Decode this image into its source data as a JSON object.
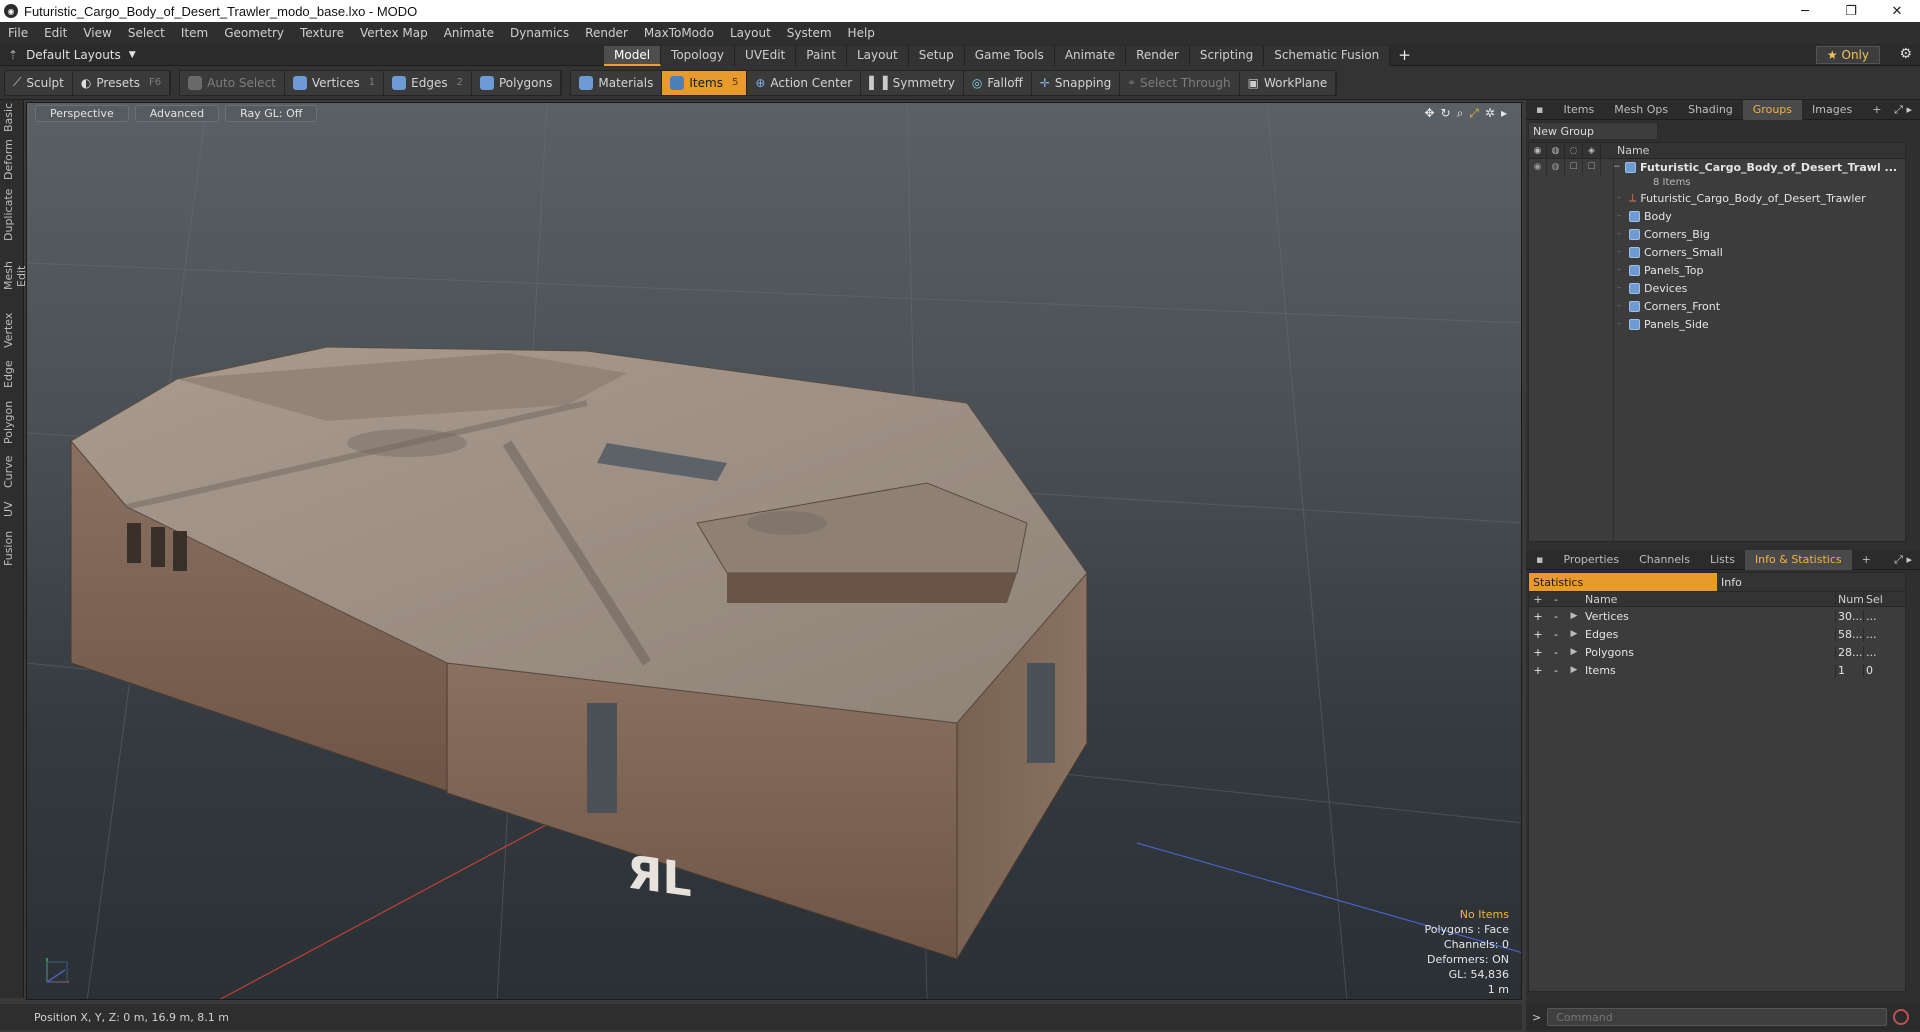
{
  "window": {
    "title": "Futuristic_Cargo_Body_of_Desert_Trawler_modo_base.lxo - MODO",
    "minimize": "─",
    "maximize": "❐",
    "close": "✕"
  },
  "menu": [
    "File",
    "Edit",
    "View",
    "Select",
    "Item",
    "Geometry",
    "Texture",
    "Vertex Map",
    "Animate",
    "Dynamics",
    "Render",
    "MaxToModo",
    "Layout",
    "System",
    "Help"
  ],
  "layout_bar": {
    "layout_selector": "Default Layouts",
    "tabs": [
      "Model",
      "Topology",
      "UVEdit",
      "Paint",
      "Layout",
      "Setup",
      "Game Tools",
      "Animate",
      "Render",
      "Scripting",
      "Schematic Fusion"
    ],
    "active_tab": "Model",
    "plus": "+",
    "only_label": "Only"
  },
  "toolbar": {
    "sculpt": "Sculpt",
    "presets": "Presets",
    "presets_key": "F6",
    "auto_select": "Auto Select",
    "vertices": "Vertices",
    "vertices_num": "1",
    "edges": "Edges",
    "edges_num": "2",
    "polygons": "Polygons",
    "materials": "Materials",
    "items": "Items",
    "items_num": "5",
    "action_center": "Action Center",
    "symmetry": "Symmetry",
    "falloff": "Falloff",
    "snapping": "Snapping",
    "select_through": "Select Through",
    "workplane": "WorkPlane"
  },
  "left_tabs": [
    "Basic",
    "Deform",
    "Duplicate",
    "Mesh Edit",
    "Vertex",
    "Edge",
    "Polygon",
    "Curve",
    "UV",
    "Fusion"
  ],
  "viewport": {
    "view_mode": "Perspective",
    "shading": "Advanced",
    "raygl": "Ray GL: Off",
    "info": {
      "items": "No Items",
      "polygons": "Polygons : Face",
      "channels": "Channels: 0",
      "deformers": "Deformers: ON",
      "gl": "GL: 54,836",
      "scale": "1 m"
    },
    "decal_text": "ЯL"
  },
  "status": {
    "position": "Position X, Y, Z:  0 m, 16.9 m, 8.1 m"
  },
  "top_panel": {
    "tabs": [
      "Items",
      "Mesh Ops",
      "Shading",
      "Groups",
      "Images"
    ],
    "active_tab": "Groups",
    "new_group": "New Group",
    "col_name": "Name",
    "group_name": "Futuristic_Cargo_Body_of_Desert_Trawl ...",
    "group_count": "8 Items",
    "children": [
      {
        "label": "Futuristic_Cargo_Body_of_Desert_Trawler",
        "icon": "locator-icon"
      },
      {
        "label": "Body",
        "icon": "mesh-icon"
      },
      {
        "label": "Corners_Big",
        "icon": "mesh-icon"
      },
      {
        "label": "Corners_Small",
        "icon": "mesh-icon"
      },
      {
        "label": "Panels_Top",
        "icon": "mesh-icon"
      },
      {
        "label": "Devices",
        "icon": "mesh-icon"
      },
      {
        "label": "Corners_Front",
        "icon": "mesh-icon"
      },
      {
        "label": "Panels_Side",
        "icon": "mesh-icon"
      }
    ]
  },
  "bottom_panel": {
    "tabs": [
      "Properties",
      "Channels",
      "Lists",
      "Info & Statistics"
    ],
    "active_tab": "Info & Statistics",
    "subtabs": [
      "Statistics",
      "Info"
    ],
    "headers": {
      "name": "Name",
      "num": "Num",
      "sel": "Sel"
    },
    "rows": [
      {
        "name": "Vertices",
        "num": "30...",
        "sel": "..."
      },
      {
        "name": "Edges",
        "num": "58...",
        "sel": "..."
      },
      {
        "name": "Polygons",
        "num": "28...",
        "sel": "..."
      },
      {
        "name": "Items",
        "num": "1",
        "sel": "0"
      }
    ]
  },
  "command": {
    "prompt": ">",
    "placeholder": "Command"
  },
  "colors": {
    "accent": "#e89a2a",
    "highlight_text": "#f2b43e"
  }
}
